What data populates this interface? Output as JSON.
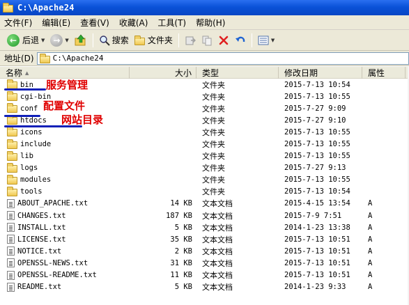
{
  "window": {
    "title": "C:\\Apache24"
  },
  "menu": [
    {
      "label": "文件(F)"
    },
    {
      "label": "编辑(E)"
    },
    {
      "label": "查看(V)"
    },
    {
      "label": "收藏(A)"
    },
    {
      "label": "工具(T)"
    },
    {
      "label": "帮助(H)"
    }
  ],
  "toolbar": {
    "back_label": "后退",
    "search_label": "搜索",
    "folders_label": "文件夹"
  },
  "address": {
    "label": "地址(D)",
    "value": "C:\\Apache24"
  },
  "columns": {
    "name": "名称",
    "size": "大小",
    "type": "类型",
    "date": "修改日期",
    "attr": "属性"
  },
  "files": [
    {
      "name": "bin",
      "size": "",
      "type": "文件夹",
      "date": "2015-7-13 10:54",
      "attr": "",
      "kind": "folder"
    },
    {
      "name": "cgi-bin",
      "size": "",
      "type": "文件夹",
      "date": "2015-7-13 10:55",
      "attr": "",
      "kind": "folder"
    },
    {
      "name": "conf",
      "size": "",
      "type": "文件夹",
      "date": "2015-7-27 9:09",
      "attr": "",
      "kind": "folder"
    },
    {
      "name": "htdocs",
      "size": "",
      "type": "文件夹",
      "date": "2015-7-27 9:10",
      "attr": "",
      "kind": "folder"
    },
    {
      "name": "icons",
      "size": "",
      "type": "文件夹",
      "date": "2015-7-13 10:55",
      "attr": "",
      "kind": "folder"
    },
    {
      "name": "include",
      "size": "",
      "type": "文件夹",
      "date": "2015-7-13 10:55",
      "attr": "",
      "kind": "folder"
    },
    {
      "name": "lib",
      "size": "",
      "type": "文件夹",
      "date": "2015-7-13 10:55",
      "attr": "",
      "kind": "folder"
    },
    {
      "name": "logs",
      "size": "",
      "type": "文件夹",
      "date": "2015-7-27 9:13",
      "attr": "",
      "kind": "folder"
    },
    {
      "name": "modules",
      "size": "",
      "type": "文件夹",
      "date": "2015-7-13 10:55",
      "attr": "",
      "kind": "folder"
    },
    {
      "name": "tools",
      "size": "",
      "type": "文件夹",
      "date": "2015-7-13 10:54",
      "attr": "",
      "kind": "folder"
    },
    {
      "name": "ABOUT_APACHE.txt",
      "size": "14 KB",
      "type": "文本文档",
      "date": "2015-4-15 13:54",
      "attr": "A",
      "kind": "file"
    },
    {
      "name": "CHANGES.txt",
      "size": "187 KB",
      "type": "文本文档",
      "date": "2015-7-9 7:51",
      "attr": "A",
      "kind": "file"
    },
    {
      "name": "INSTALL.txt",
      "size": "5 KB",
      "type": "文本文档",
      "date": "2014-1-23 13:38",
      "attr": "A",
      "kind": "file"
    },
    {
      "name": "LICENSE.txt",
      "size": "35 KB",
      "type": "文本文档",
      "date": "2015-7-13 10:51",
      "attr": "A",
      "kind": "file"
    },
    {
      "name": "NOTICE.txt",
      "size": "2 KB",
      "type": "文本文档",
      "date": "2015-7-13 10:51",
      "attr": "A",
      "kind": "file"
    },
    {
      "name": "OPENSSL-NEWS.txt",
      "size": "31 KB",
      "type": "文本文档",
      "date": "2015-7-13 10:51",
      "attr": "A",
      "kind": "file"
    },
    {
      "name": "OPENSSL-README.txt",
      "size": "11 KB",
      "type": "文本文档",
      "date": "2015-7-13 10:51",
      "attr": "A",
      "kind": "file"
    },
    {
      "name": "README.txt",
      "size": "5 KB",
      "type": "文本文档",
      "date": "2014-1-23 9:33",
      "attr": "A",
      "kind": "file"
    }
  ],
  "annotations": {
    "bin": "服务管理",
    "conf": "配置文件",
    "htdocs": "网站目录"
  },
  "colors": {
    "titlebar": "#0a52d8",
    "annotation": "#e00000",
    "underline": "#1020b8"
  }
}
